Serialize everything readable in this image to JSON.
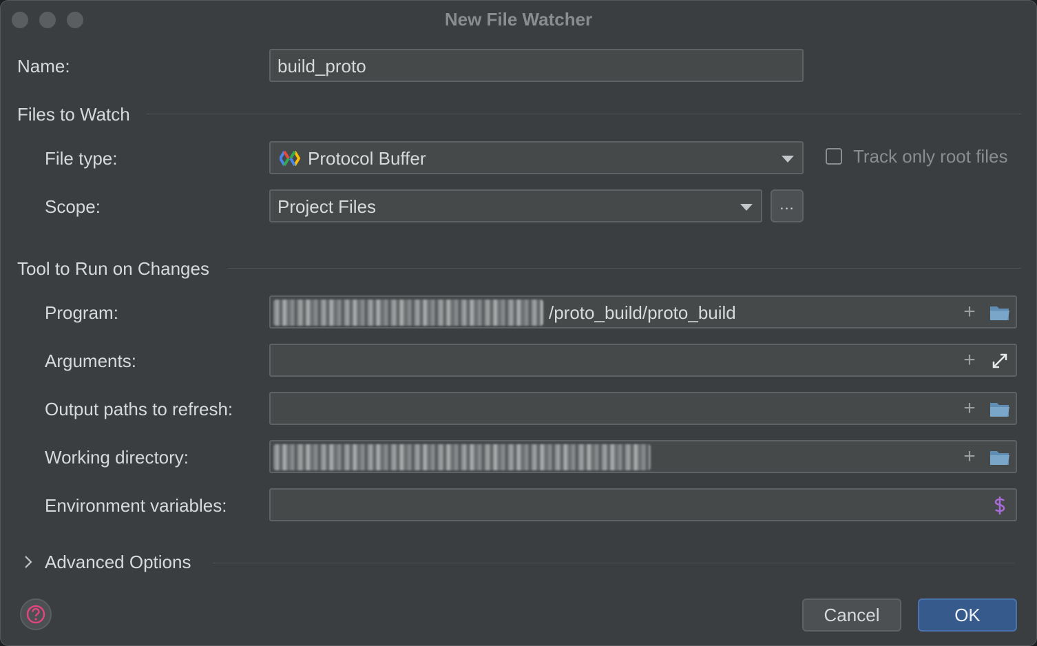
{
  "window": {
    "title": "New File Watcher"
  },
  "name": {
    "label": "Name:",
    "value": "build_proto"
  },
  "files_to_watch": {
    "section_title": "Files to Watch",
    "file_type_label": "File type:",
    "file_type_value": "Protocol Buffer",
    "track_only_root_label": "Track only root files",
    "track_only_root_checked": false,
    "scope_label": "Scope:",
    "scope_value": "Project Files",
    "scope_more_label": "..."
  },
  "tool": {
    "section_title": "Tool to Run on Changes",
    "program_label": "Program:",
    "program_value_visible": "/proto_build/proto_build",
    "arguments_label": "Arguments:",
    "arguments_value": "",
    "output_paths_label": "Output paths to refresh:",
    "output_paths_value": "",
    "working_dir_label": "Working directory:",
    "env_vars_label": "Environment variables:",
    "env_vars_value": ""
  },
  "advanced": {
    "label": "Advanced Options",
    "expanded": false
  },
  "footer": {
    "cancel_label": "Cancel",
    "ok_label": "OK"
  },
  "colors": {
    "window_bg": "#3b3e41",
    "field_bg": "#45494a",
    "accent_ok": "#375a8c",
    "help_icon": "#e0457b",
    "env_icon": "#a96bd9",
    "folder_icon": "#5f8db4"
  },
  "icons": {
    "file_type": "protobuf-icon",
    "dropdown": "chevron-down-icon",
    "add": "plus-icon",
    "folder": "folder-icon",
    "expand": "expand-icon",
    "env": "dollar-icon",
    "help": "help-icon",
    "advanced": "chevron-right-icon"
  }
}
